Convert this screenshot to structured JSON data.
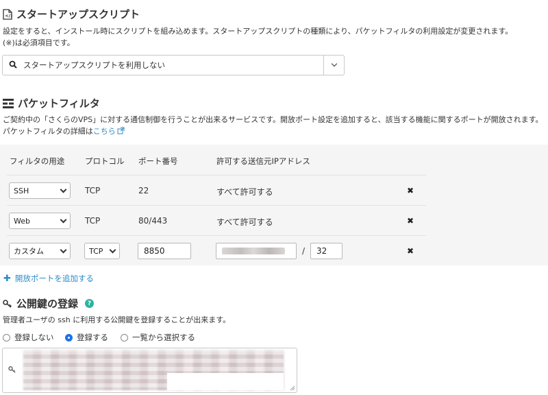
{
  "startup": {
    "icon": "script-file-icon",
    "title": "スタートアップスクリプト",
    "desc1": "設定をすると、インストール時にスクリプトを組み込めます。スタートアップスクリプトの種類により、パケットフィルタの利用設定が変更されます。",
    "desc2": "(※)は必須項目です。",
    "select_value": "スタートアップスクリプトを利用しない"
  },
  "packet": {
    "icon": "firewall-icon",
    "title": "パケットフィルタ",
    "desc1": "ご契約中の「さくらのVPS」に対する通信制御を行うことが出来るサービスです。開放ポート設定を追加すると、該当する機能に関するポートが開放されます。",
    "desc2_prefix": "パケットフィルタの詳細は",
    "desc2_link": "こちら",
    "headers": [
      "フィルタの用途",
      "プロトコル",
      "ポート番号",
      "許可する送信元IPアドレス"
    ],
    "rows": [
      {
        "usage": "SSH",
        "protocol": "TCP",
        "port": "22",
        "source": "すべて許可する"
      },
      {
        "usage": "Web",
        "protocol": "TCP",
        "port": "80/443",
        "source": "すべて許可する"
      }
    ],
    "custom_row": {
      "usage": "カスタム",
      "protocol": "TCP",
      "port": "8850",
      "slash": "/",
      "mask": "32"
    },
    "add_port": "開放ポートを追加する"
  },
  "pubkey": {
    "title": "公開鍵の登録",
    "desc": "管理者ユーザの ssh に利用する公開鍵を登録することが出来ます。",
    "options": [
      "登録しない",
      "登録する",
      "一覧から選択する"
    ],
    "selected_index": 1
  }
}
